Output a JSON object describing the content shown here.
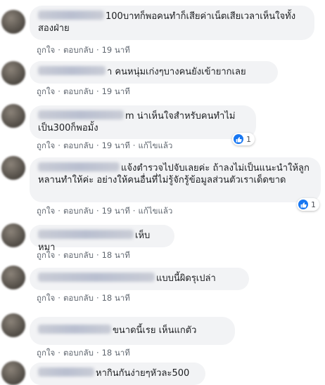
{
  "actions": {
    "like": "ถูกใจ",
    "reply": "ตอบกลับ",
    "edited": "แก้ไขแล้ว",
    "dot": "·"
  },
  "comments": [
    {
      "text": "100บาทก็พอคนทำก็เสียค่าเน็ตเสียเวลาเห็นใจทั้งสองฝ่าย",
      "time": "19 นาที"
    },
    {
      "text": "า คนหนุ่มเก่งๆบางคนยังเข้ายากเลย",
      "time": "19 นาที"
    },
    {
      "text": "m น่าเห็นใจสำหรับคนทำไม่เป็น300ก็พอมั้ง",
      "time": "19 นาที",
      "edited": true,
      "reactions": "1"
    },
    {
      "text": "แจ้งตำรวจไปจับเลยค่ะ ถ้าลงไม่เป็นแนะนำให้ลูกหลานทำให้ค่ะ อย่างให้คนอื่นที่ไม่รู้จักรู้ข้อมูลส่วนตัวเราเด็ดขาด",
      "time": "19 นาที",
      "edited": true,
      "reactions": "1"
    },
    {
      "text": "เห็บหมา",
      "time": "18 นาที"
    },
    {
      "text": "แบบนี้ผิดรุเปล่า",
      "time": "18 นาที"
    },
    {
      "text": "ขนาดนี้เรย เห็นแกตัว",
      "time": "18 นาที"
    },
    {
      "text": "หากินกันง่ายๆหัวละ500",
      "time": ""
    }
  ]
}
